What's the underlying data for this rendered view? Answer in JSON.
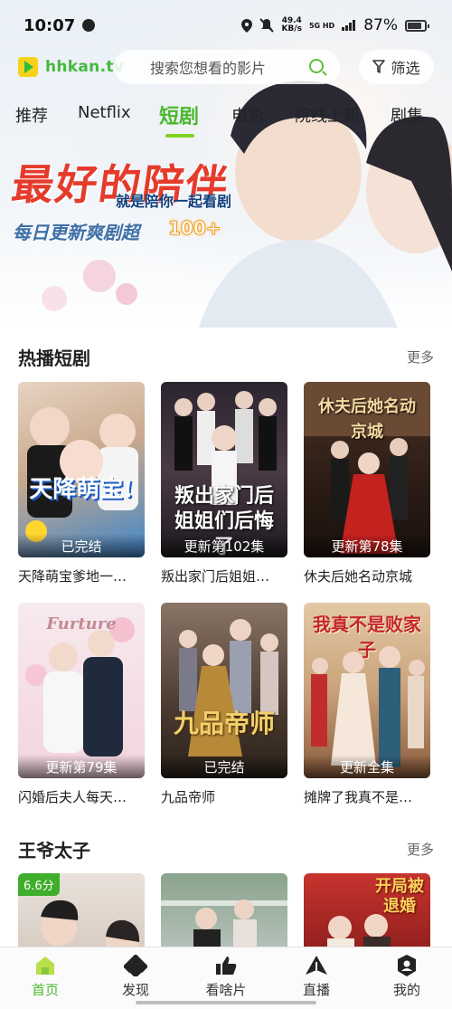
{
  "status_bar": {
    "time": "10:07",
    "net_speed": "49.4",
    "net_unit": "KB/s",
    "network_badge": "5G HD",
    "battery": "87%"
  },
  "header": {
    "logo_text": "hhkan.tv",
    "search_placeholder": "搜索您想看的影片",
    "filter_label": "筛选"
  },
  "tabs": [
    {
      "label": "推荐",
      "active": false
    },
    {
      "label": "Netflix",
      "active": false
    },
    {
      "label": "短剧",
      "active": true
    },
    {
      "label": "电影",
      "active": false
    },
    {
      "label": "院线上新",
      "active": false
    },
    {
      "label": "剧集",
      "active": false
    }
  ],
  "banner": {
    "title": "最好的陪伴",
    "subtitle": "就是陪你一起看剧",
    "daily_text": "每日更新爽剧超",
    "count_text": "100+"
  },
  "sections": [
    {
      "title": "热播短剧",
      "more": "更多",
      "items": [
        {
          "title": "天降萌宝爹地一…",
          "tag": "已完结",
          "caption": "天降萌宝!"
        },
        {
          "title": "叛出家门后姐姐…",
          "tag": "更新第102集",
          "caption": "叛出家门后姐姐们后悔了"
        },
        {
          "title": "休夫后她名动京城",
          "tag": "更新第78集",
          "caption": "休夫后她名动京城"
        },
        {
          "title": "闪婚后夫人每天…",
          "tag": "更新第79集",
          "caption": "Furture"
        },
        {
          "title": "九品帝师",
          "tag": "已完结",
          "caption": "九品帝师"
        },
        {
          "title": "摊牌了我真不是…",
          "tag": "更新全集",
          "caption": "我真不是败家子"
        }
      ]
    },
    {
      "title": "王爷太子",
      "more": "更多",
      "items": [
        {
          "score": "6.6分"
        },
        {},
        {
          "caption": "开局被退婚"
        }
      ]
    }
  ],
  "bottom_nav": [
    {
      "label": "首页",
      "icon": "home-icon",
      "active": true
    },
    {
      "label": "发现",
      "icon": "discover-icon",
      "active": false
    },
    {
      "label": "看啥片",
      "icon": "thumbs-up-icon",
      "active": false
    },
    {
      "label": "直播",
      "icon": "live-icon",
      "active": false
    },
    {
      "label": "我的",
      "icon": "profile-icon",
      "active": false
    }
  ],
  "colors": {
    "accent": "#4cb82f",
    "banner_red": "#e53b2c",
    "badge_green": "#3fae2a"
  }
}
